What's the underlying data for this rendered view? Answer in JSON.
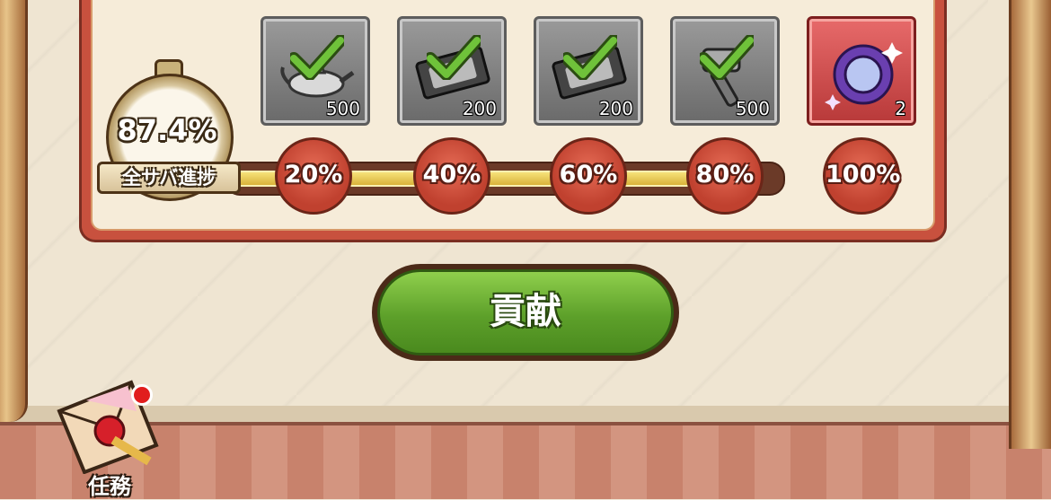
{
  "progress": {
    "percent_text": "87.4%",
    "label": "全サバ進捗",
    "value": 0.874
  },
  "rewards": [
    {
      "icon": "magic-lamp-icon",
      "quantity": "500",
      "claimed": true
    },
    {
      "icon": "ticket-icon",
      "quantity": "200",
      "claimed": true
    },
    {
      "icon": "ticket-icon",
      "quantity": "200",
      "claimed": true
    },
    {
      "icon": "hammer-icon",
      "quantity": "500",
      "claimed": true
    },
    {
      "icon": "purple-gear-gem-icon",
      "quantity": "2",
      "claimed": false
    }
  ],
  "milestones": [
    "20%",
    "40%",
    "60%",
    "80%",
    "100%"
  ],
  "contribute_button": {
    "label": "貢献"
  },
  "mission": {
    "label": "任務",
    "has_notification": true
  },
  "colors": {
    "panel_red": "#c8513e",
    "button_green": "#5da02a",
    "track_gold": "#e7c24a",
    "check_green": "#6fc23a"
  }
}
